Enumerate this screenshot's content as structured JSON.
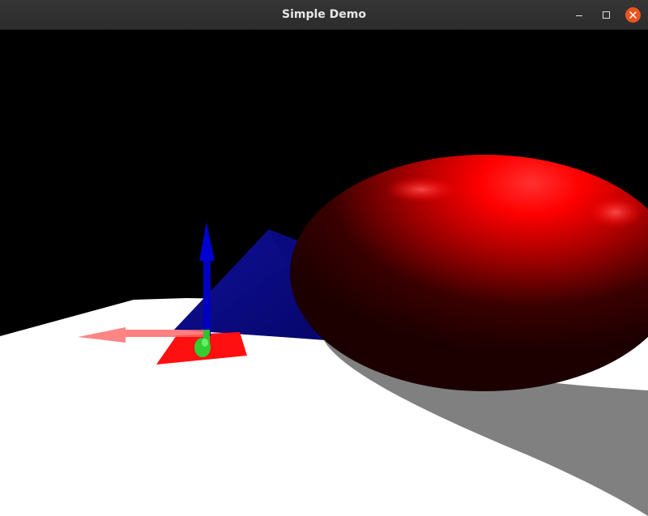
{
  "window": {
    "title": "Simple Demo",
    "controls": {
      "minimize_icon": "minimize-icon",
      "maximize_icon": "maximize-icon",
      "close_icon": "close-icon"
    },
    "accent_close": "#e95420"
  },
  "scene": {
    "background": "#000000",
    "objects": [
      {
        "name": "ground-plane",
        "color": "#ffffff"
      },
      {
        "name": "pyramid",
        "color": "#0a0a8a"
      },
      {
        "name": "ellipsoid",
        "color": "#ff0000"
      },
      {
        "name": "ellipsoid-shadow",
        "color": "#808080"
      },
      {
        "name": "marker-triangle",
        "color": "#ff0000"
      }
    ],
    "gizmo": {
      "x_axis_color": "#ff6060",
      "y_axis_color": "#00ff00",
      "z_axis_color": "#0000c8"
    }
  }
}
